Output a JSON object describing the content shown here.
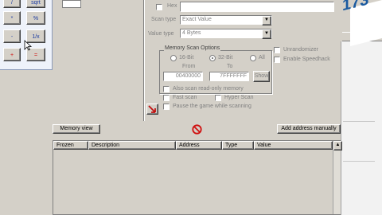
{
  "calculator": {
    "row0": [
      "/",
      "sqrt"
    ],
    "row1": [
      "*",
      "%"
    ],
    "row2": [
      "-",
      "1/x"
    ],
    "row3": [
      "+",
      "="
    ]
  },
  "scan": {
    "hex_label": "Hex",
    "value": "",
    "scan_type_label": "Scan type",
    "scan_type_value": "Exact Value",
    "value_type_label": "Value type",
    "value_type_value": "4 Bytes",
    "memory_options_title": "Memory Scan Options",
    "bit16_label": "16-Bit",
    "bit32_label": "32-Bit",
    "all_label": "All",
    "from_label": "From",
    "to_label": "To",
    "from_value": "00400000",
    "to_value": "7FFFFFFF",
    "show_button": "Show",
    "also_scan_label": "Also scan read-only memory",
    "fast_scan_label": "Fast scan",
    "hyper_scan_label": "Hyper Scan",
    "pause_label": "Pause the game while scanning",
    "unrandomizer_label": "Unrandomizer",
    "speedhack_label": "Enable Speedhack"
  },
  "buttons": {
    "memory_view": "Memory view",
    "add_address": "Add address manually"
  },
  "table": {
    "columns": [
      "Frozen",
      "Description",
      "Address",
      "Type",
      "Value"
    ]
  },
  "logo": {
    "number": "173"
  },
  "colors": {
    "face": "#d4d0c8",
    "logo_blue": "#1a5aa0",
    "stop_red": "#d01010"
  }
}
